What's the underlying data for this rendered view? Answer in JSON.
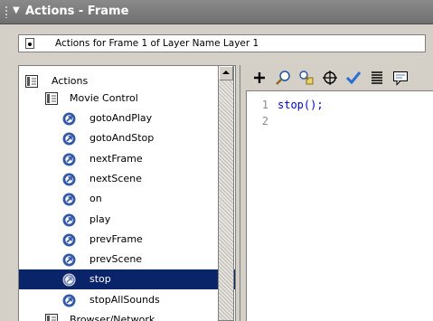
{
  "panel": {
    "title": "Actions - Frame"
  },
  "location": {
    "label": "Actions for Frame 1 of Layer Name Layer 1"
  },
  "toolbox": {
    "root": {
      "label": "Actions",
      "icon": "book-icon"
    },
    "category": {
      "label": "Movie Control",
      "icon": "book-icon"
    },
    "items": [
      {
        "label": "gotoAndPlay",
        "icon": "action-circle-icon",
        "selected": false
      },
      {
        "label": "gotoAndStop",
        "icon": "action-circle-icon",
        "selected": false
      },
      {
        "label": "nextFrame",
        "icon": "action-circle-icon",
        "selected": false
      },
      {
        "label": "nextScene",
        "icon": "action-circle-icon",
        "selected": false
      },
      {
        "label": "on",
        "icon": "action-circle-icon",
        "selected": false
      },
      {
        "label": "play",
        "icon": "action-circle-icon",
        "selected": false
      },
      {
        "label": "prevFrame",
        "icon": "action-circle-icon",
        "selected": false
      },
      {
        "label": "prevScene",
        "icon": "action-circle-icon",
        "selected": false
      },
      {
        "label": "stop",
        "icon": "action-circle-icon",
        "selected": true
      },
      {
        "label": "stopAllSounds",
        "icon": "action-circle-icon",
        "selected": false
      }
    ],
    "next_category": {
      "label": "Browser/Network",
      "icon": "book-icon"
    }
  },
  "script_toolbar": {
    "buttons": [
      {
        "icon": "add-plus-icon"
      },
      {
        "icon": "find-icon"
      },
      {
        "icon": "replace-icon"
      },
      {
        "icon": "target-path-icon"
      },
      {
        "icon": "check-syntax-icon"
      },
      {
        "icon": "auto-format-icon"
      },
      {
        "icon": "code-hint-icon"
      }
    ]
  },
  "editor": {
    "lines": [
      {
        "num": "1",
        "code": "stop();"
      },
      {
        "num": "2",
        "code": ""
      }
    ]
  },
  "colors": {
    "selection": "#0a246a",
    "code": "#0000cc",
    "titlebar": "#7d7d7d"
  }
}
